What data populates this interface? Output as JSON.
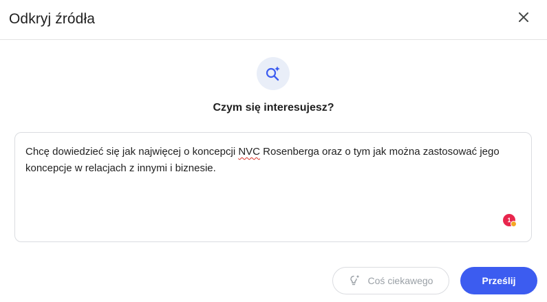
{
  "dialog": {
    "title": "Odkryj źródła",
    "close_icon": "close-icon",
    "hero_icon": "search-sparkle-icon",
    "question": "Czym się interesujesz?"
  },
  "input": {
    "text_before": "Chcę dowiedzieć się jak najwięcej o koncepcji ",
    "misspelled": "NVC",
    "text_after": " Rosenberga oraz o tym jak można zastosować jego koncepcje w relacjach z innymi i biznesie.",
    "badge_count": "1"
  },
  "actions": {
    "suggest_label": "Coś ciekawego",
    "suggest_icon": "lightbulb-sparkle-icon",
    "submit_label": "Prześlij"
  },
  "colors": {
    "accent": "#3c5cf0",
    "hero_bg": "#e9eef8",
    "badge": "#e8264d"
  }
}
